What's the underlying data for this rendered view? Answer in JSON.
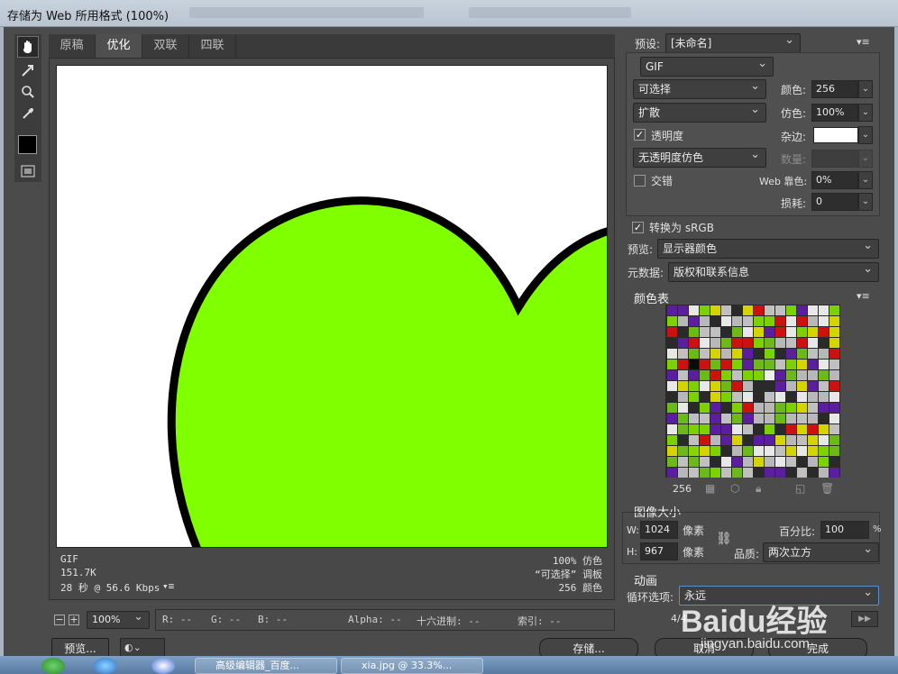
{
  "window": {
    "title": "存储为 Web 所用格式 (100%)"
  },
  "tabs": [
    "原稿",
    "优化",
    "双联",
    "四联"
  ],
  "image_info": {
    "left": [
      "GIF",
      "151.7K",
      "28 秒 @ 56.6 Kbps"
    ],
    "right": [
      "100% 仿色",
      "“可选择” 调板",
      "256 颜色"
    ]
  },
  "status": {
    "zoom": "100%",
    "r": "R: --",
    "g": "G: --",
    "b": "B: --",
    "alpha": "Alpha: --",
    "hex": "十六进制: --",
    "index": "索引: --"
  },
  "settings": {
    "preset_label": "预设:",
    "preset_value": "[未命名]",
    "format": "GIF",
    "reduction": "可选择",
    "dither_algo": "扩散",
    "transparency_label": "透明度",
    "transparency_dither": "无透明度仿色",
    "interlaced_label": "交错",
    "colors_label": "颜色:",
    "colors_value": "256",
    "dither_label": "仿色:",
    "dither_value": "100%",
    "matte_label": "杂边:",
    "amount_label": "数量:",
    "websnap_label": "Web 靠色:",
    "websnap_value": "0%",
    "lossy_label": "损耗:",
    "lossy_value": "0",
    "convert_srgb": "转换为 sRGB",
    "preview_label": "预览:",
    "preview_value": "显示器颜色",
    "metadata_label": "元数据:",
    "metadata_value": "版权和联系信息"
  },
  "color_table": {
    "title": "颜色表",
    "count": "256"
  },
  "image_size": {
    "title": "图像大小",
    "w_label": "W:",
    "w_value": "1024",
    "w_unit": "像素",
    "h_label": "H:",
    "h_value": "967",
    "h_unit": "像素",
    "percent_label": "百分比:",
    "percent_value": "100",
    "percent_unit": "%",
    "quality_label": "品质:",
    "quality_value": "两次立方"
  },
  "animation": {
    "title": "动画",
    "loop_label": "循环选项:",
    "loop_value": "永远",
    "frame": "4/4"
  },
  "buttons": {
    "preview": "预览...",
    "save": "存储...",
    "cancel": "取消",
    "done": "完成"
  },
  "taskbar": {
    "app1": "高级编辑器_百度...",
    "app2": "xia.jpg @ 33.3%..."
  },
  "watermark": {
    "text": "Baidu经验",
    "url": "jingyan.baidu.com"
  },
  "colors": {
    "heart_fill": "#80ff00",
    "heart_stroke": "#000000",
    "panel_bg": "#535353"
  }
}
